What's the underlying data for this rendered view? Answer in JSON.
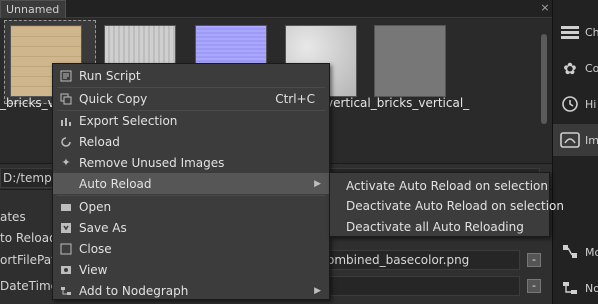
{
  "tabs": {
    "active_label": "Unnamed",
    "close_glyph": "×"
  },
  "right_panel": {
    "items": [
      {
        "icon": "channels-icon",
        "label": "Ch"
      },
      {
        "icon": "cog-flower-icon",
        "label": "Co"
      },
      {
        "icon": "history-icon",
        "label": "Hi"
      },
      {
        "icon": "image-icon",
        "label": "Im"
      },
      {
        "icon": "nodes-icon",
        "label": "Mo"
      },
      {
        "icon": "nodegraph-icon",
        "label": "No"
      }
    ]
  },
  "thumbnails": {
    "labels": [
      "_bricks_v",
      "vertical_bricks_vertical_"
    ]
  },
  "path": {
    "value": "D:/temp"
  },
  "properties": {
    "labels": [
      "ates",
      "to Reload",
      "ortFilePath",
      "DateTime"
    ],
    "values": [
      "ombined_basecolor.png",
      ""
    ],
    "minus_glyph": "-"
  },
  "context_menu": {
    "items": [
      {
        "label": "Run Script",
        "icon": "script-icon",
        "shortcut": "",
        "submenu": false
      },
      {
        "label": "Quick Copy",
        "icon": "copy-icon",
        "shortcut": "Ctrl+C",
        "submenu": false
      },
      {
        "label": "Export Selection",
        "icon": "export-icon",
        "shortcut": "",
        "submenu": false
      },
      {
        "label": "Reload",
        "icon": "reload-icon",
        "shortcut": "",
        "submenu": false
      },
      {
        "label": "Remove Unused Images",
        "icon": "remove-icon",
        "shortcut": "",
        "submenu": false
      },
      {
        "label": "Auto Reload",
        "icon": "",
        "shortcut": "",
        "submenu": true,
        "active": true
      },
      {
        "label": "Open",
        "icon": "open-icon",
        "shortcut": "",
        "submenu": false
      },
      {
        "label": "Save As",
        "icon": "save-icon",
        "shortcut": "",
        "submenu": false
      },
      {
        "label": "Close",
        "icon": "close-icon",
        "shortcut": "",
        "submenu": false
      },
      {
        "label": "View",
        "icon": "view-icon",
        "shortcut": "",
        "submenu": false
      },
      {
        "label": "Add to Nodegraph",
        "icon": "nodegraph-icon",
        "shortcut": "",
        "submenu": true
      }
    ]
  },
  "submenu": {
    "items": [
      "Activate Auto Reload on selection",
      "Deactivate Auto Reload on selection",
      "Deactivate all Auto Reloading"
    ]
  },
  "colors": {
    "background": "#2b2b2b",
    "menu_bg": "#3c3c3c",
    "menu_active": "#565656",
    "text": "#e2e2e2"
  }
}
